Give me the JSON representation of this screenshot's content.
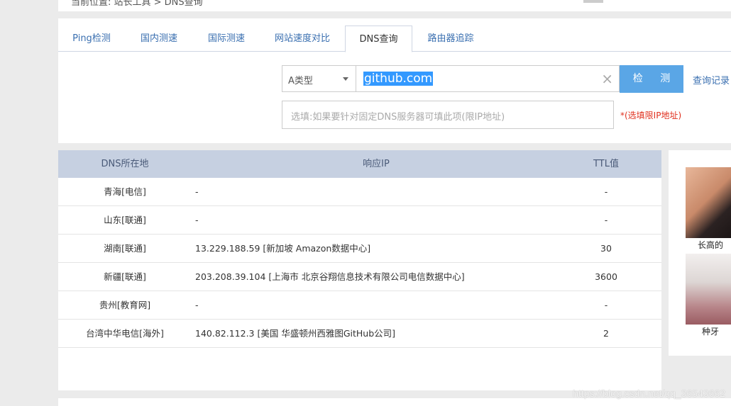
{
  "top_strip": {
    "crumb": "当前位置: 站长工具 > DNS查询"
  },
  "tabs": [
    {
      "label": "Ping检测",
      "active": false
    },
    {
      "label": "国内测速",
      "active": false
    },
    {
      "label": "国际测速",
      "active": false
    },
    {
      "label": "网站速度对比",
      "active": false
    },
    {
      "label": "DNS查询",
      "active": true
    },
    {
      "label": "路由器追踪",
      "active": false
    }
  ],
  "query": {
    "record_type": "A类型",
    "domain_value": "github.com",
    "clear_glyph": "×",
    "detect_label": "检 测",
    "history_label": "查询记录",
    "dns_placeholder": "选填:如果要针对固定DNS服务器可填此项(限IP地址)",
    "dns_hint": "*(选填限IP地址)"
  },
  "results": {
    "headers": {
      "location": "DNS所在地",
      "ip": "响应IP",
      "ttl": "TTL值"
    },
    "rows": [
      {
        "location": "青海[电信]",
        "ip": "-",
        "ttl": "-"
      },
      {
        "location": "山东[联通]",
        "ip": "-",
        "ttl": "-"
      },
      {
        "location": "湖南[联通]",
        "ip": "13.229.188.59 [新加坡 Amazon数据中心]",
        "ttl": "30"
      },
      {
        "location": "新疆[联通]",
        "ip": "203.208.39.104 [上海市 北京谷翔信息技术有限公司电信数据中心]",
        "ttl": "3600"
      },
      {
        "location": "贵州[教育网]",
        "ip": "-",
        "ttl": "-"
      },
      {
        "location": "台湾中华电信[海外]",
        "ip": "140.82.112.3 [美国 华盛顿州西雅图GitHub公司]",
        "ttl": "2"
      }
    ]
  },
  "ads": [
    {
      "caption": "长高的",
      "color": "#d9a78a"
    },
    {
      "caption": "种牙",
      "color": "#c9bfbb"
    }
  ],
  "watermark": "https://blog.csdn.net/qq_36543662",
  "colors": {
    "accent": "#3a6fb0",
    "button": "#5aa6e6",
    "header_bg": "#c6d0e1",
    "hint": "#e0301e"
  }
}
